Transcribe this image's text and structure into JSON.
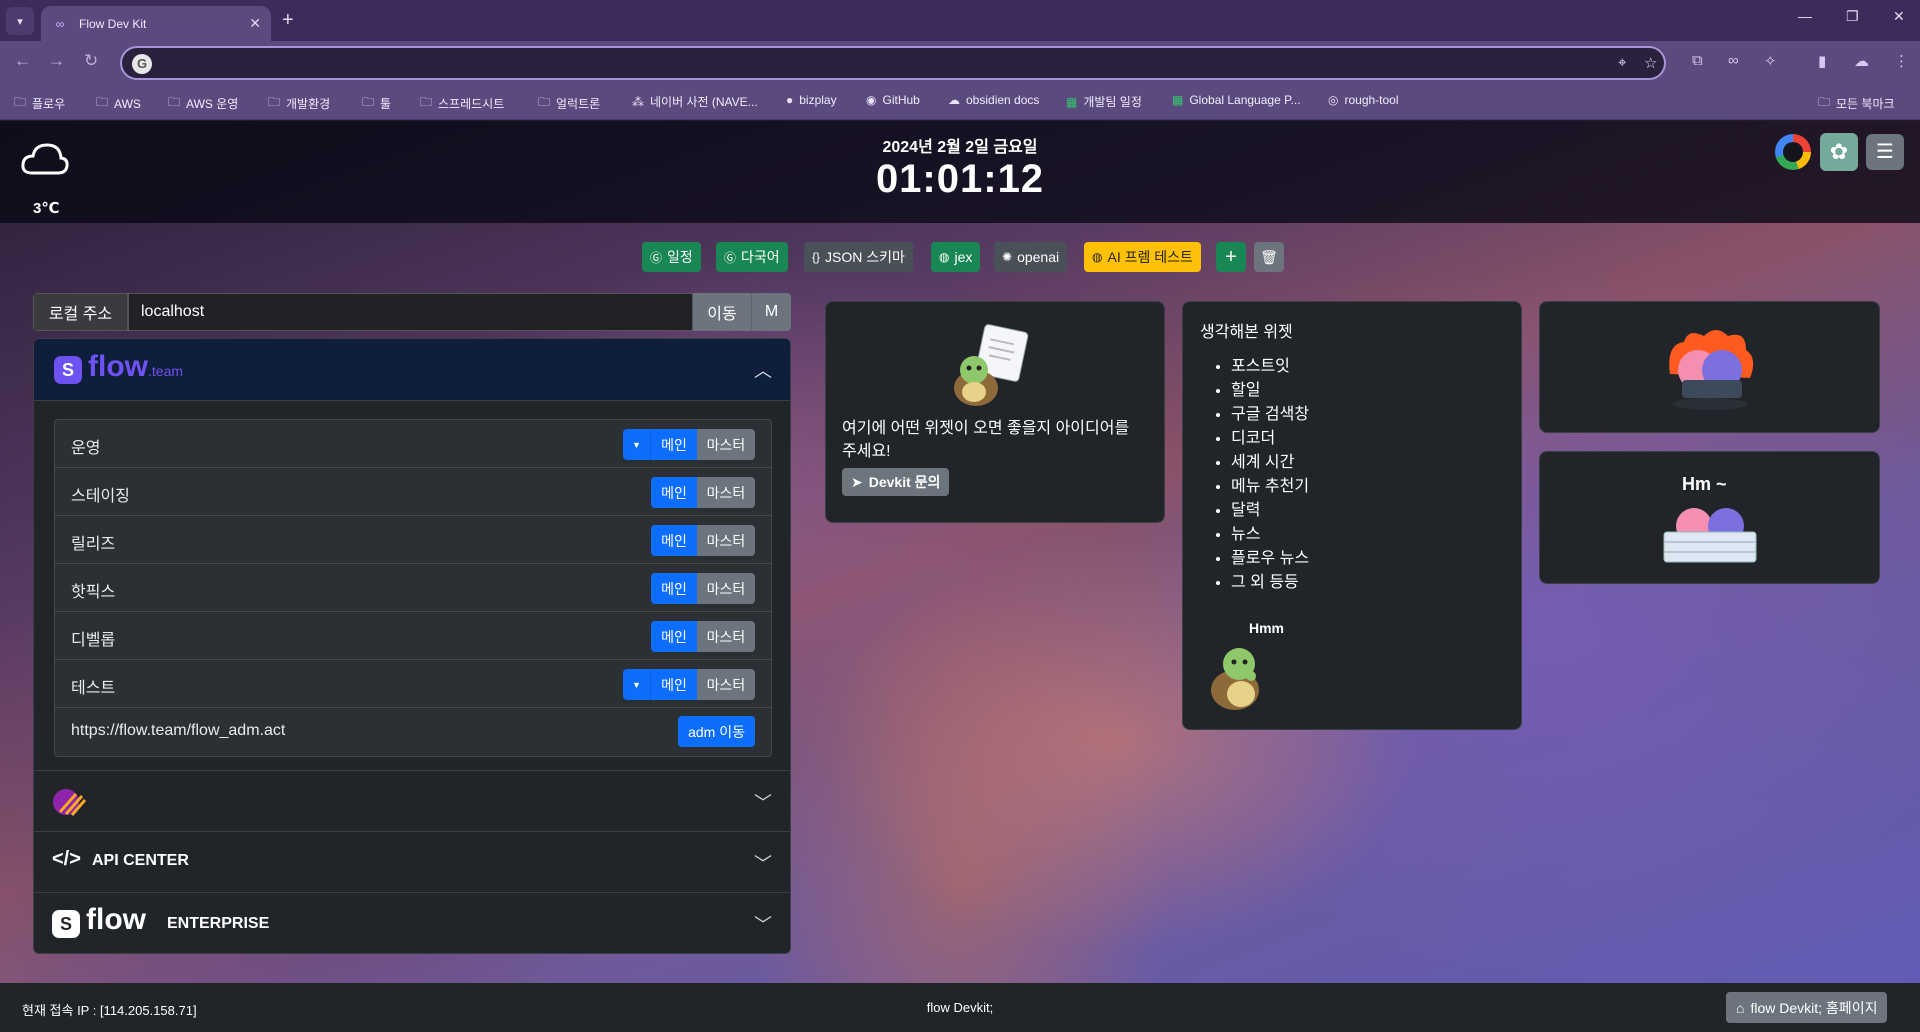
{
  "browser": {
    "tab_title": "Flow Dev Kit",
    "tab_close": "✕",
    "new_tab": "+",
    "window_controls": {
      "minimize": "—",
      "restore": "❐",
      "close": "✕"
    },
    "address_value": "",
    "bookmarks": [
      {
        "label": "플로우",
        "icon": "folder-icon"
      },
      {
        "label": "AWS",
        "icon": "folder-icon"
      },
      {
        "label": "AWS 운영",
        "icon": "folder-icon"
      },
      {
        "label": "개발환경",
        "icon": "folder-icon"
      },
      {
        "label": "툴",
        "icon": "folder-icon"
      },
      {
        "label": "스프레드시트",
        "icon": "folder-icon"
      },
      {
        "label": "얼럭트론",
        "icon": "folder-icon"
      },
      {
        "label": "네이버 사전 (NAVE...",
        "icon": "naver-dict-icon"
      },
      {
        "label": "bizplay",
        "icon": "bizplay-icon"
      },
      {
        "label": "GitHub",
        "icon": "github-icon"
      },
      {
        "label": "obsidien docs",
        "icon": "cloud-icon"
      },
      {
        "label": "개발팀 일정",
        "icon": "sheets-icon"
      },
      {
        "label": "Global Language P...",
        "icon": "sheets-icon"
      },
      {
        "label": "rough-tool",
        "icon": "globe-icon"
      }
    ],
    "all_bookmarks": "모든 북마크"
  },
  "header": {
    "temperature": "3℃",
    "date": "2024년 2월 2일 금요일",
    "time": "01:01:12",
    "menu_icon": "hamburger-icon"
  },
  "quick_links": [
    {
      "label": "일정",
      "icon": "google-icon",
      "color": "#198754"
    },
    {
      "label": "다국어",
      "icon": "google-icon",
      "color": "#198754"
    },
    {
      "label": "JSON 스키마",
      "icon": "json-icon",
      "color": "#495057"
    },
    {
      "label": "jex",
      "icon": "globe-icon",
      "color": "#198754"
    },
    {
      "label": "openai",
      "icon": "openai-icon",
      "color": "#495057"
    },
    {
      "label": "AI 프렘 테스트",
      "icon": "globe-icon",
      "color": "#ffc107"
    }
  ],
  "local_address": {
    "label": "로컬 주소",
    "value": "localhost",
    "go_label": "이동",
    "m_label": "M"
  },
  "flow_team": {
    "logo_text": "flow",
    "logo_suffix": ".team",
    "environments": [
      {
        "name": "운영",
        "has_dropdown": true,
        "main": "메인",
        "master": "마스터"
      },
      {
        "name": "스테이징",
        "has_dropdown": false,
        "main": "메인",
        "master": "마스터"
      },
      {
        "name": "릴리즈",
        "has_dropdown": false,
        "main": "메인",
        "master": "마스터"
      },
      {
        "name": "핫픽스",
        "has_dropdown": false,
        "main": "메인",
        "master": "마스터"
      },
      {
        "name": "디벨롭",
        "has_dropdown": false,
        "main": "메인",
        "master": "마스터"
      },
      {
        "name": "테스트",
        "has_dropdown": true,
        "main": "메인",
        "master": "마스터"
      }
    ],
    "adm_url": "https://flow.team/flow_adm.act",
    "adm_button": "adm 이동"
  },
  "accordion_sections": [
    {
      "label": "",
      "icon": "stripe-logo-icon"
    },
    {
      "label": "API CENTER",
      "icon": "code-icon"
    },
    {
      "label": "flow",
      "suffix": "ENTERPRISE",
      "icon": "flow-logo-icon"
    }
  ],
  "idea_widget": {
    "text": "여기에 어떤 위젯이 오면 좋을지 아이디어를 주세요!",
    "button": "Devkit 문의"
  },
  "list_widget": {
    "title": "생각해본 위젯",
    "items": [
      "포스트잇",
      "할일",
      "구글 검색창",
      "디코더",
      "세계 시간",
      "메뉴 추천기",
      "달력",
      "뉴스",
      "플로우 뉴스",
      "그 외 등등"
    ],
    "sticker_text": "Hmm"
  },
  "sticker_widget": {
    "text": "Hm ~"
  },
  "footer": {
    "ip": "현재 접속 IP : [114.205.158.71]",
    "center": "flow Devkit;",
    "home_button": "flow Devkit; 홈페이지"
  }
}
